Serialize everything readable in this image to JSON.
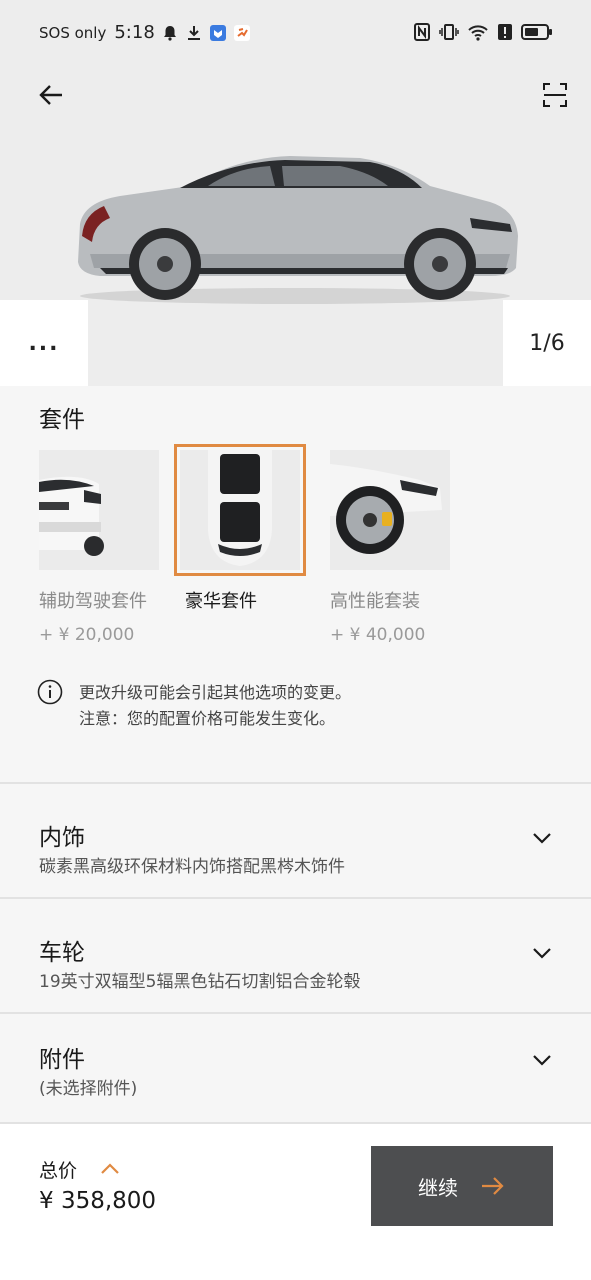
{
  "status_bar": {
    "carrier": "SOS only",
    "time": "5:18"
  },
  "hero": {
    "more_label": "...",
    "image_counter": "1/6"
  },
  "packages": {
    "title": "套件",
    "items": [
      {
        "name": "辅助驾驶套件",
        "price": "+ ¥ 20,000",
        "selected": false
      },
      {
        "name": "豪华套件",
        "price": "",
        "selected": true
      },
      {
        "name": "高性能套装",
        "price": "+ ¥ 40,000",
        "selected": false
      }
    ],
    "info_line1": "更改升级可能会引起其他选项的变更。",
    "info_line2": "注意：您的配置价格可能发生变化。"
  },
  "sections": [
    {
      "title": "内饰",
      "subtitle": "碳素黑高级环保材料内饰搭配黑梣木饰件"
    },
    {
      "title": "车轮",
      "subtitle": "19英寸双辐型5辐黑色钻石切割铝合金轮毂"
    },
    {
      "title": "附件",
      "subtitle": "(未选择附件)"
    }
  ],
  "footer": {
    "total_label": "总价",
    "total_price": "¥ 358,800",
    "continue_label": "继续"
  },
  "colors": {
    "accent": "#e08a42",
    "button_bg": "#4d4e50",
    "page_bg": "#f6f6f6"
  }
}
